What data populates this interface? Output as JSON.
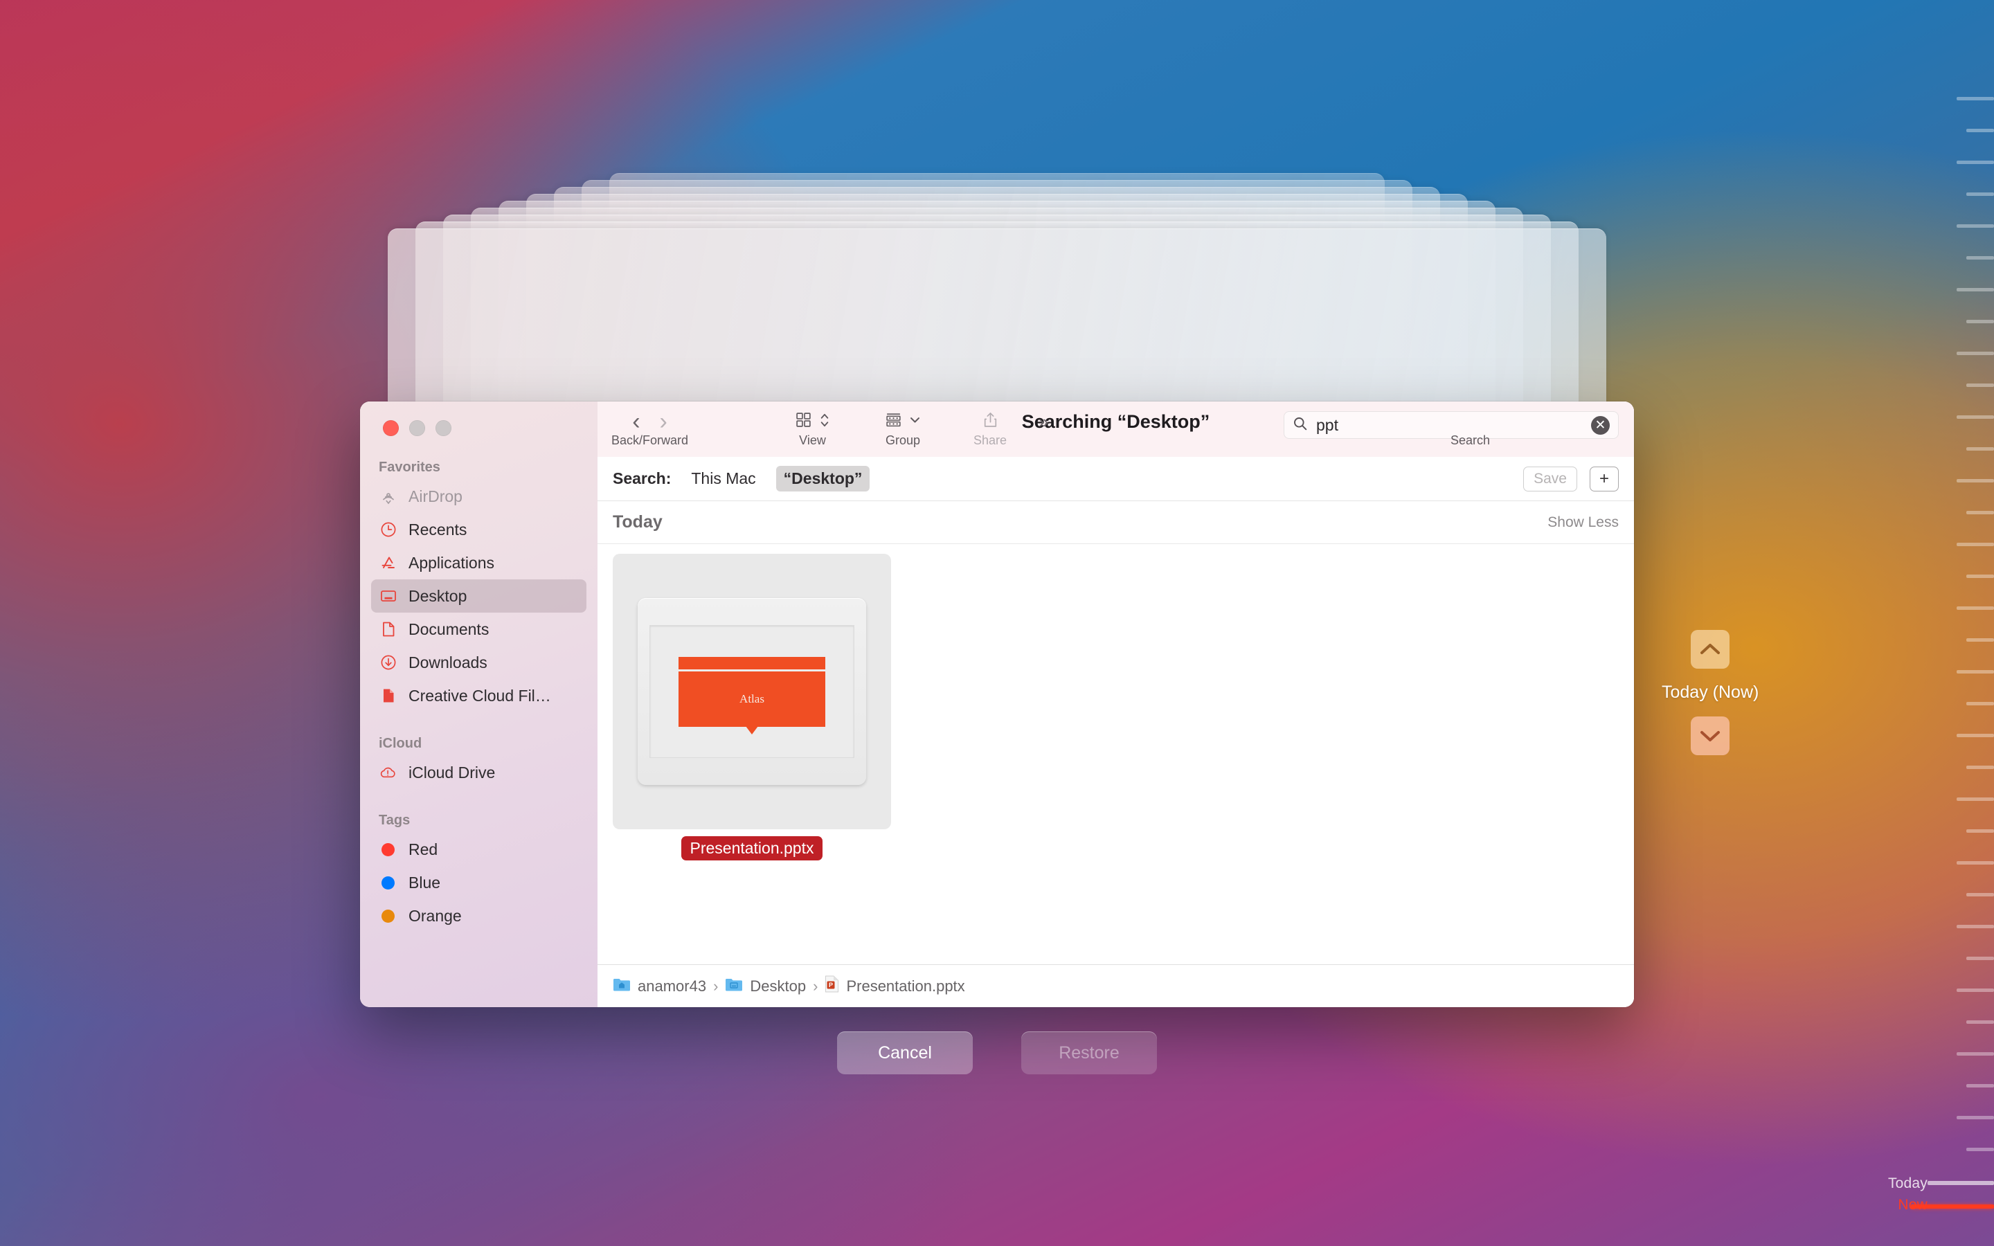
{
  "window": {
    "title": "Searching “Desktop”",
    "traffic_lights": [
      "close",
      "minimize",
      "maximize"
    ]
  },
  "toolbar": {
    "back_label": "‹",
    "forward_label": "›",
    "back_forward_caption": "Back/Forward",
    "view_caption": "View",
    "group_caption": "Group",
    "share_caption": "Share",
    "more_label": "»",
    "search_caption": "Search",
    "search_value": "ppt",
    "search_placeholder": "Search",
    "clear_label": "✕"
  },
  "scopebar": {
    "label": "Search:",
    "options": [
      {
        "label": "This Mac",
        "active": false
      },
      {
        "label": "“Desktop”",
        "active": true
      }
    ],
    "save_label": "Save",
    "add_label": "+"
  },
  "group_header": {
    "title": "Today",
    "show_less": "Show Less"
  },
  "files": [
    {
      "name": "Presentation.pptx",
      "selected": true,
      "preview_text": "Atlas",
      "preview_accent": "#f04e23"
    }
  ],
  "pathbar": {
    "crumbs": [
      "anamor43",
      "Desktop",
      "Presentation.pptx"
    ],
    "separator": "›"
  },
  "sidebar": {
    "sections": [
      {
        "title": "Favorites",
        "items": [
          {
            "label": "AirDrop",
            "icon": "airdrop-icon",
            "state": "dim"
          },
          {
            "label": "Recents",
            "icon": "clock-icon",
            "state": "normal"
          },
          {
            "label": "Applications",
            "icon": "applications-icon",
            "state": "normal"
          },
          {
            "label": "Desktop",
            "icon": "desktop-icon",
            "state": "selected"
          },
          {
            "label": "Documents",
            "icon": "document-icon",
            "state": "normal"
          },
          {
            "label": "Downloads",
            "icon": "download-icon",
            "state": "normal"
          },
          {
            "label": "Creative Cloud Fil…",
            "icon": "creative-cloud-icon",
            "state": "normal"
          }
        ]
      },
      {
        "title": "iCloud",
        "items": [
          {
            "label": "iCloud Drive",
            "icon": "icloud-icon",
            "state": "normal"
          }
        ]
      },
      {
        "title": "Tags",
        "items": [
          {
            "label": "Red",
            "icon": "tag-dot-icon",
            "color": "#ff3b30",
            "state": "normal"
          },
          {
            "label": "Blue",
            "icon": "tag-dot-icon",
            "color": "#007aff",
            "state": "normal"
          },
          {
            "label": "Orange",
            "icon": "tag-dot-icon",
            "color": "#e8890c",
            "state": "normal"
          }
        ]
      }
    ]
  },
  "actions": {
    "cancel_label": "Cancel",
    "restore_label": "Restore",
    "restore_enabled": false
  },
  "timemachine": {
    "current_label": "Today (Now)",
    "up_icon": "chevron-up-icon",
    "down_icon": "chevron-down-icon",
    "timeline": {
      "today_label": "Today",
      "now_label": "Now"
    }
  }
}
